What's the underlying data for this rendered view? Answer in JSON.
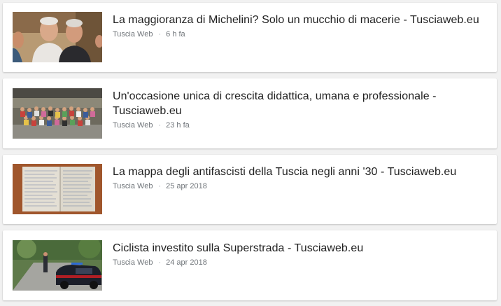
{
  "articles": [
    {
      "title": "La maggioranza di Michelini? Solo un mucchio di macerie - Tusciaweb.eu",
      "source": "Tuscia Web",
      "separator": "·",
      "time": "6 h fa",
      "thumbnail": "two-smiling-men-photo"
    },
    {
      "title": "Un'occasione unica di crescita didattica, umana e professionale - Tusciaweb.eu",
      "source": "Tuscia Web",
      "separator": "·",
      "time": "23 h fa",
      "thumbnail": "students-group-photo"
    },
    {
      "title": "La mappa degli antifascisti della Tuscia negli anni '30 - Tusciaweb.eu",
      "source": "Tuscia Web",
      "separator": "·",
      "time": "25 apr 2018",
      "thumbnail": "handwritten-ledger-photo"
    },
    {
      "title": "Ciclista investito sulla Superstrada - Tusciaweb.eu",
      "source": "Tuscia Web",
      "separator": "·",
      "time": "24 apr 2018",
      "thumbnail": "carabinieri-car-photo"
    }
  ]
}
